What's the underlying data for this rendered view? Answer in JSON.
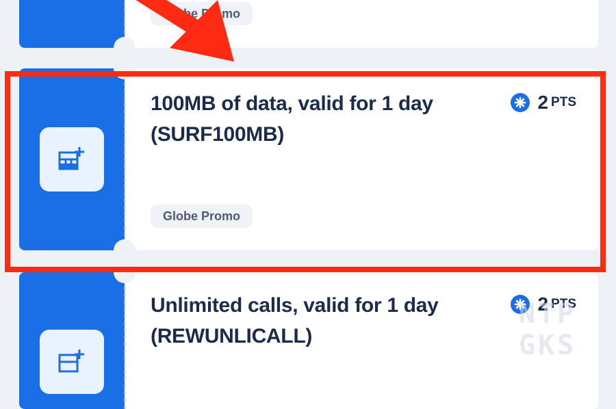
{
  "colors": {
    "accent_blue": "#1a6fe6",
    "highlight_red": "#ff2a12",
    "text_dark": "#1c2b4a",
    "badge_bg": "#eff2f6"
  },
  "watermark": "NTP\nGKS",
  "offers": [
    {
      "icon": "sim-plus-icon",
      "title": "",
      "badge": "Globe Promo",
      "points": "",
      "points_unit": ""
    },
    {
      "icon": "sim-plus-icon",
      "title": "100MB of data, valid for 1 day (SURF100MB)",
      "badge": "Globe Promo",
      "points": "2",
      "points_unit": "PTS"
    },
    {
      "icon": "sim-plus-icon",
      "title": "Unlimited calls, valid for 1 day (REWUNLICALL)",
      "badge": "",
      "points": "2",
      "points_unit": "PTS"
    }
  ]
}
